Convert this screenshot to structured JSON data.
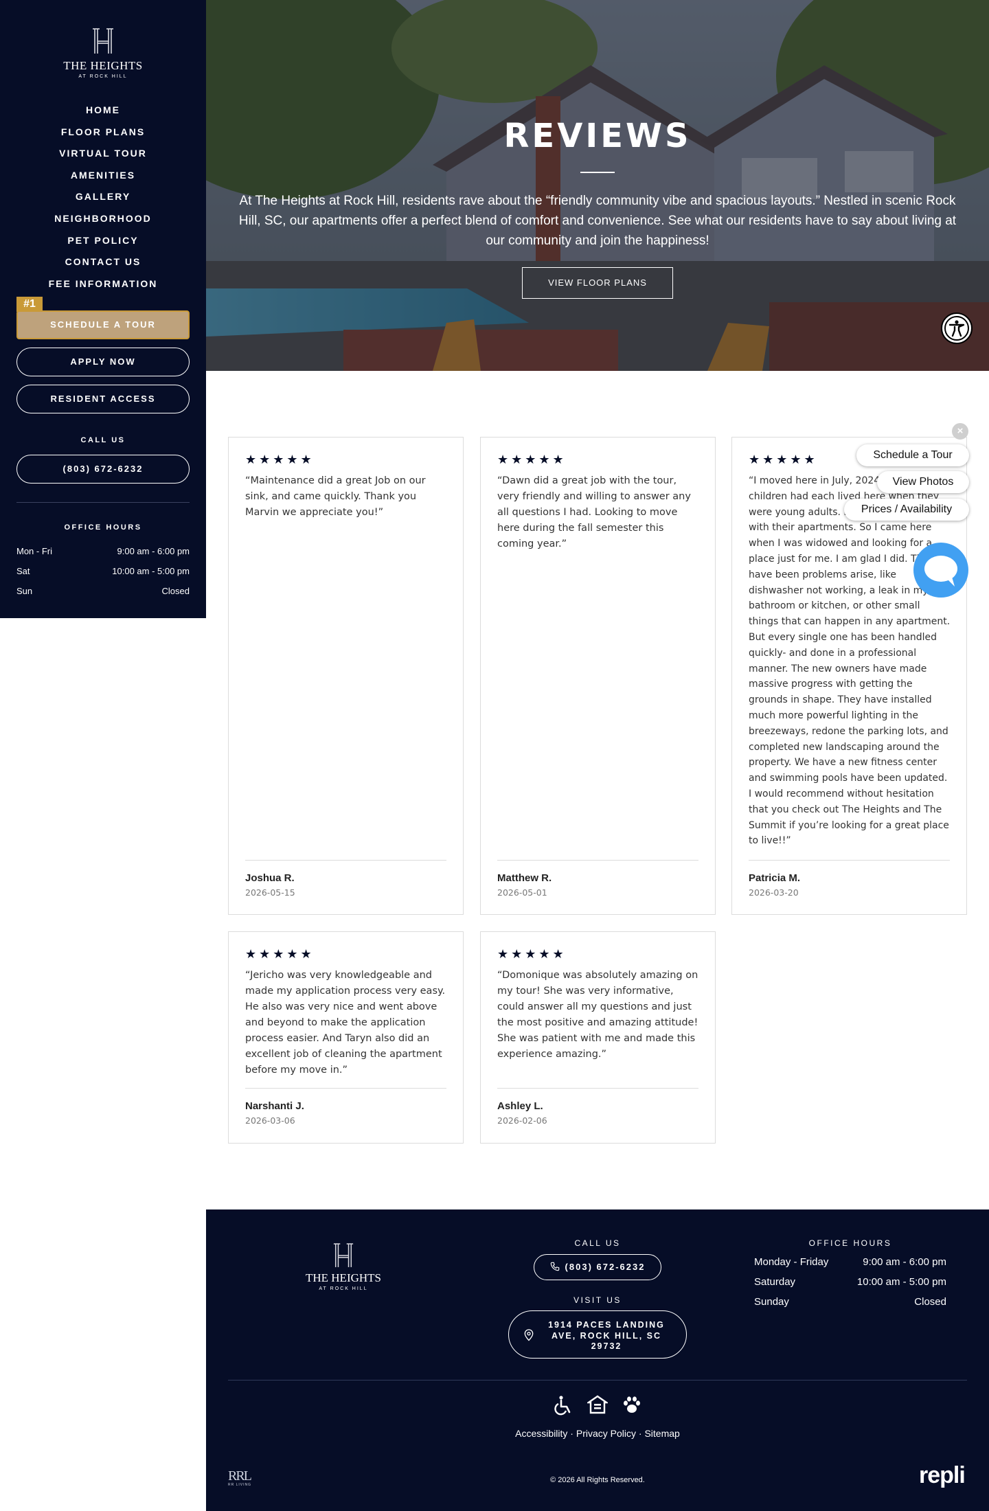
{
  "brand": {
    "name": "THE HEIGHTS",
    "sub": "AT ROCK HILL"
  },
  "nav": [
    "HOME",
    "FLOOR PLANS",
    "VIRTUAL TOUR",
    "AMENITIES",
    "GALLERY",
    "NEIGHBORHOOD",
    "PET POLICY",
    "CONTACT US",
    "FEE INFORMATION"
  ],
  "sidebar": {
    "badge": "#1",
    "schedule_tour": "SCHEDULE A TOUR",
    "apply_now": "APPLY NOW",
    "resident_access": "RESIDENT ACCESS",
    "call_us_label": "CALL US",
    "phone": "(803) 672-6232",
    "office_hours_label": "OFFICE HOURS",
    "hours": [
      {
        "day": "Mon - Fri",
        "time": "9:00 am - 6:00 pm"
      },
      {
        "day": "Sat",
        "time": "10:00 am - 5:00 pm"
      },
      {
        "day": "Sun",
        "time": "Closed"
      }
    ]
  },
  "hero": {
    "title": "REVIEWS",
    "text": "At The Heights at Rock Hill, residents rave about the “friendly community vibe and spacious layouts.” Nestled in scenic Rock Hill, SC, our apartments offer a perfect blend of comfort and convenience. See what our residents have to say about living at our community and join the happiness!",
    "button": "VIEW FLOOR PLANS"
  },
  "reviews": [
    {
      "stars": "★★★★★",
      "quote": "“Maintenance did a great Job on our sink, and came quickly. Thank you Marvin we appreciate you!”",
      "author": "Joshua R.",
      "date": "2026-05-15"
    },
    {
      "stars": "★★★★★",
      "quote": "“Dawn did a great job with the tour, very friendly and willing to answer any all questions I had. Looking to move here during the fall semester this coming year.”",
      "author": "Matthew R.",
      "date": "2026-05-01"
    },
    {
      "stars": "★★★★★",
      "quote": "“I moved here in July, 2024. Two of my children had each lived here when they were young adults. I was always pleased with their apartments. So I came here when I was widowed and looking for a place just for me. I am glad I did. There have been problems arise, like dishwasher not working, a leak in my bathroom or kitchen, or other small things that can happen in any apartment. But every single one has been handled quickly- and done in a professional manner. The new owners have made massive progress with getting the grounds in shape. They have installed much more powerful lighting in the breezeways, redone the parking lots, and completed new landscaping around the property. We have a new fitness center and swimming pools have been updated. I would recommend without hesitation that you check out The Heights and The Summit if you’re looking for a great place to live!!”",
      "author": "Patricia M.",
      "date": "2026-03-20"
    },
    {
      "stars": "★★★★★",
      "quote": "“Jericho was very knowledgeable and made my application process very easy. He also was very nice and went above and beyond to make the application process easier. And Taryn also did an excellent job of cleaning the apartment before my move in.”",
      "author": "Narshanti J.",
      "date": "2026-03-06"
    },
    {
      "stars": "★★★★★",
      "quote": "“Domonique was absolutely amazing on my tour! She was very informative, could answer all my questions and just the most positive and amazing attitude! She was patient with me and made this experience amazing.”",
      "author": "Ashley L.",
      "date": "2026-02-06"
    }
  ],
  "floating": {
    "close": "×",
    "schedule": "Schedule a Tour",
    "photos": "View Photos",
    "prices": "Prices / Availability"
  },
  "footer": {
    "call_us_label": "CALL US",
    "phone": "(803) 672-6232",
    "visit_us_label": "VISIT US",
    "address": "1914 PACES LANDING AVE, ROCK HILL, SC 29732",
    "office_hours_label": "OFFICE HOURS",
    "hours": [
      {
        "day": "Monday - Friday",
        "time": "9:00 am - 6:00 pm"
      },
      {
        "day": "Saturday",
        "time": "10:00 am - 5:00 pm"
      },
      {
        "day": "Sunday",
        "time": "Closed"
      }
    ],
    "links": [
      "Accessibility",
      "Privacy Policy",
      "Sitemap"
    ],
    "separator": " · ",
    "copyright": "© 2026 All Rights Reserved.",
    "rr_logo": "RRL",
    "rr_sub": "RR LIVING",
    "repli": "repli"
  },
  "colors": {
    "navy": "#060d27",
    "gold": "#c99a38",
    "tan": "#bea27c",
    "chat": "#41a0f2"
  }
}
